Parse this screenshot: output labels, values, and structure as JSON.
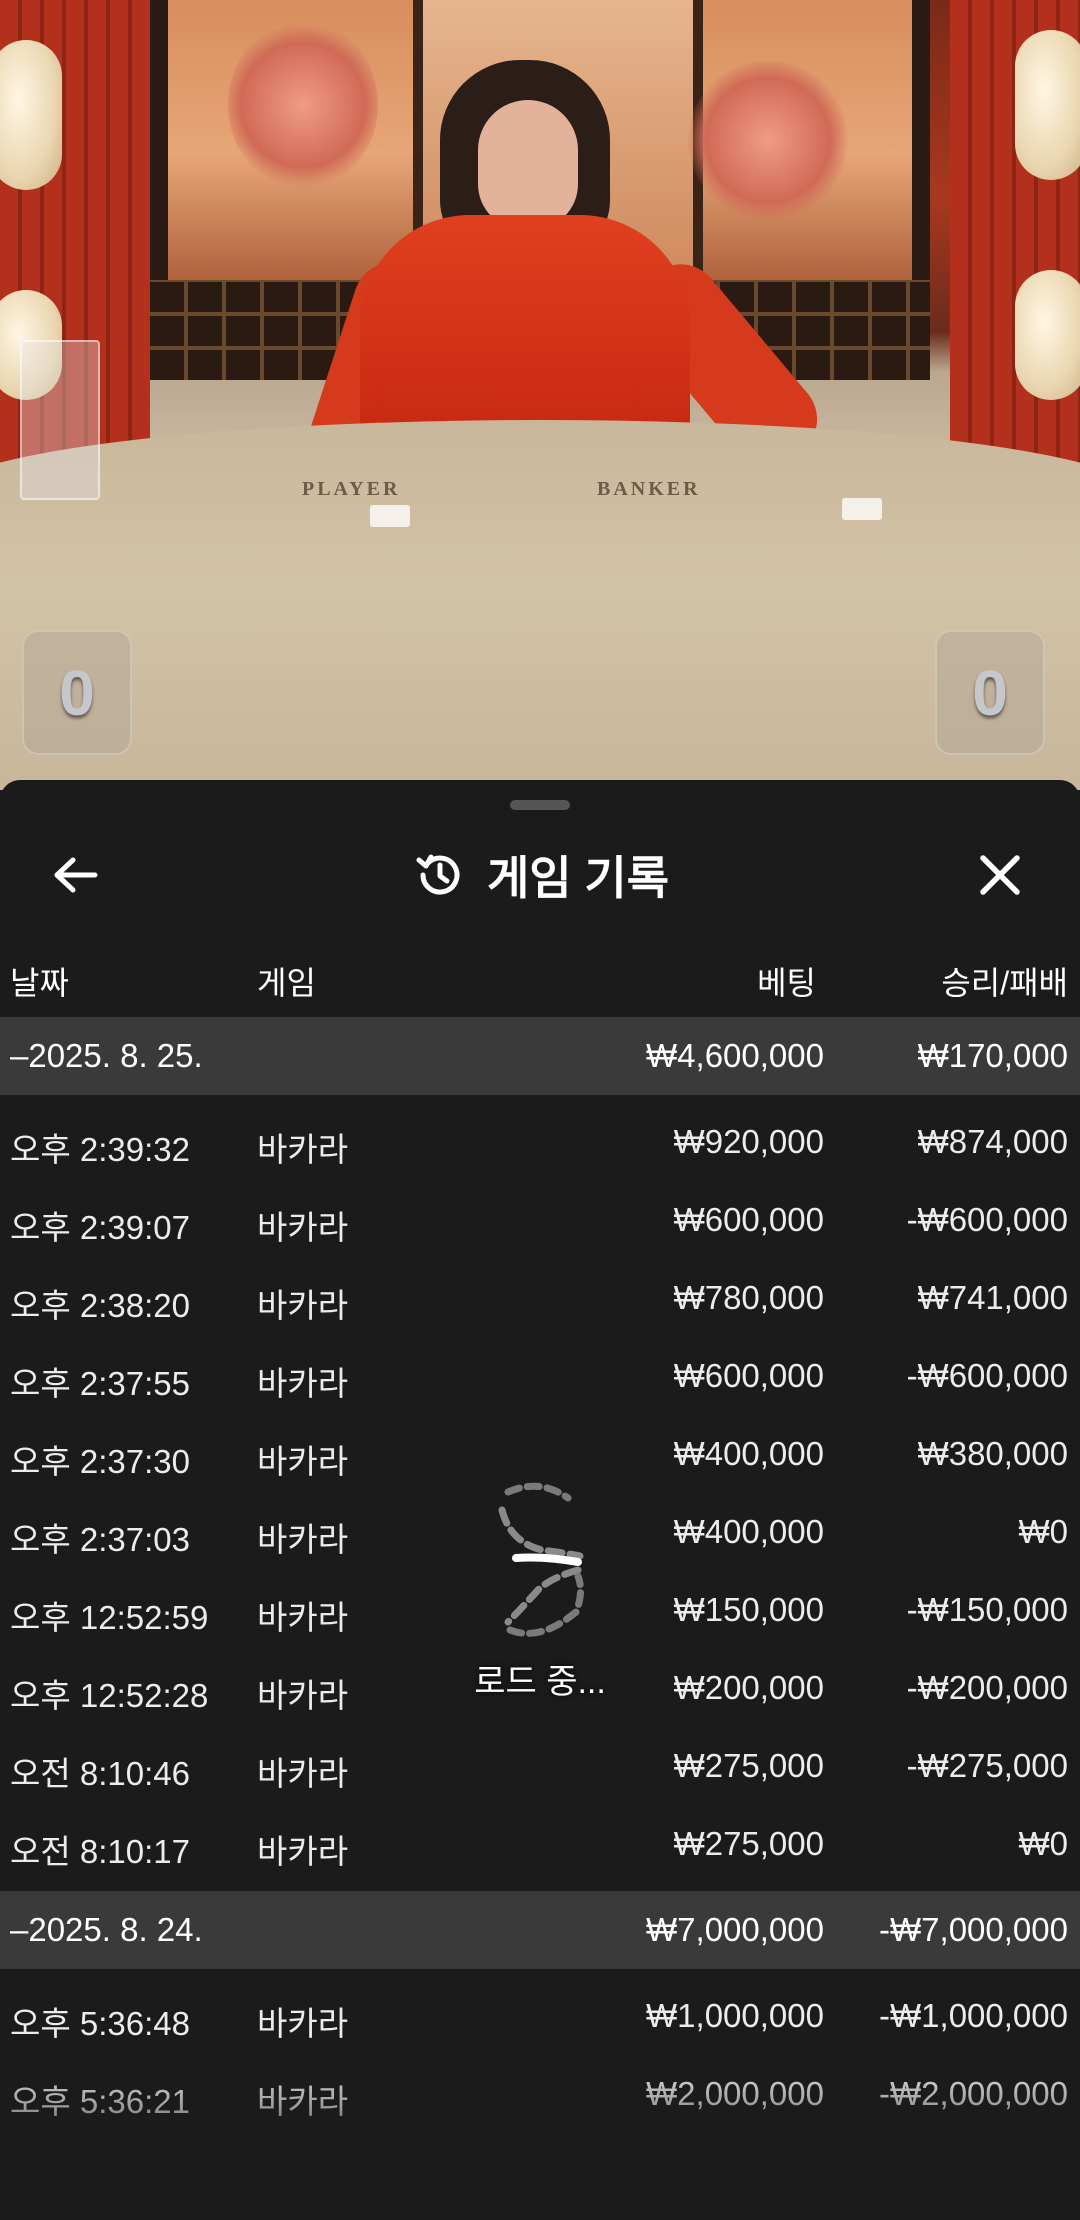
{
  "video": {
    "table_labels": {
      "player": "PLAYER",
      "banker": "BANKER"
    },
    "player_score": "0",
    "banker_score": "0"
  },
  "sheet": {
    "title": "게임 기록",
    "icons": {
      "back": "arrow-left-icon",
      "history": "history-icon",
      "close": "close-icon"
    },
    "columns": {
      "date": "날짜",
      "game": "게임",
      "bet": "베팅",
      "win_loss": "승리/패배"
    },
    "groups": [
      {
        "date": "–2025. 8. 25.",
        "total_bet": "₩4,600,000",
        "total_result": "₩170,000",
        "rows": [
          {
            "time": "오후 2:39:32",
            "game": "바카라",
            "bet": "₩920,000",
            "result": "₩874,000"
          },
          {
            "time": "오후 2:39:07",
            "game": "바카라",
            "bet": "₩600,000",
            "result": "-₩600,000"
          },
          {
            "time": "오후 2:38:20",
            "game": "바카라",
            "bet": "₩780,000",
            "result": "₩741,000"
          },
          {
            "time": "오후 2:37:55",
            "game": "바카라",
            "bet": "₩600,000",
            "result": "-₩600,000"
          },
          {
            "time": "오후 2:37:30",
            "game": "바카라",
            "bet": "₩400,000",
            "result": "₩380,000"
          },
          {
            "time": "오후 2:37:03",
            "game": "바카라",
            "bet": "₩400,000",
            "result": "₩0"
          },
          {
            "time": "오후 12:52:59",
            "game": "바카라",
            "bet": "₩150,000",
            "result": "-₩150,000"
          },
          {
            "time": "오후 12:52:28",
            "game": "바카라",
            "bet": "₩200,000",
            "result": "-₩200,000"
          },
          {
            "time": "오전 8:10:46",
            "game": "바카라",
            "bet": "₩275,000",
            "result": "-₩275,000"
          },
          {
            "time": "오전 8:10:17",
            "game": "바카라",
            "bet": "₩275,000",
            "result": "₩0"
          }
        ]
      },
      {
        "date": "–2025. 8. 24.",
        "total_bet": "₩7,000,000",
        "total_result": "-₩7,000,000",
        "rows": [
          {
            "time": "오후 5:36:48",
            "game": "바카라",
            "bet": "₩1,000,000",
            "result": "-₩1,000,000"
          },
          {
            "time": "오후 5:36:21",
            "game": "바카라",
            "bet": "₩2,000,000",
            "result": "-₩2,000,000"
          }
        ]
      }
    ],
    "loading_text": "로드 중..."
  }
}
